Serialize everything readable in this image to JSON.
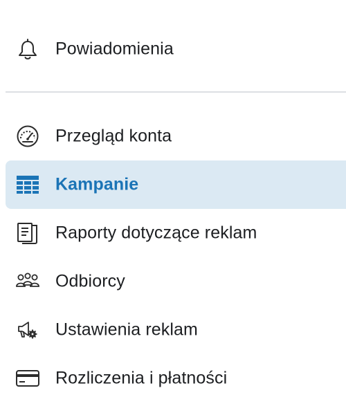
{
  "menu": {
    "top_items": [
      {
        "label": "Powiadomienia",
        "icon": "bell-icon"
      }
    ],
    "items": [
      {
        "label": "Przegląd konta",
        "icon": "gauge-icon"
      },
      {
        "label": "Kampanie",
        "icon": "table-grid-icon",
        "active": true
      },
      {
        "label": "Raporty dotyczące reklam",
        "icon": "report-icon"
      },
      {
        "label": "Odbiorcy",
        "icon": "audience-icon"
      },
      {
        "label": "Ustawienia reklam",
        "icon": "ad-settings-icon"
      },
      {
        "label": "Rozliczenia i płatności",
        "icon": "credit-card-icon"
      }
    ]
  },
  "colors": {
    "accent": "#1b74b6",
    "active_background": "#dbe9f3",
    "text": "#1c1e21",
    "divider": "#dcdfe3"
  }
}
